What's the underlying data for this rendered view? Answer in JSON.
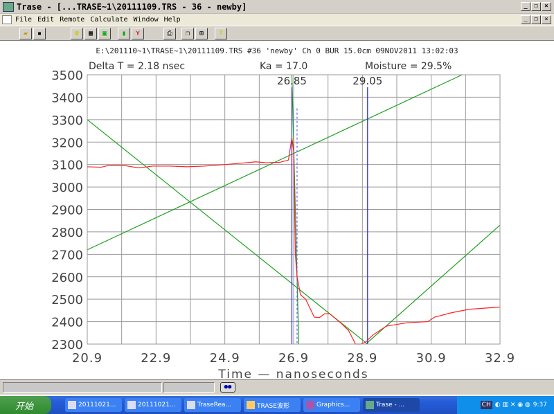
{
  "window": {
    "title": "Trase - [...TRASE~1\\20111109.TRS - 36 - newby]"
  },
  "menu": [
    "File",
    "Edit",
    "Remote",
    "Calculate",
    "Window",
    "Help"
  ],
  "toolbar": [
    "open-icon",
    "save-icon",
    "phone-icon",
    "table-icon",
    "monitor-icon",
    "green-doc-icon",
    "waveform-icon",
    "print-icon",
    "cascade-icon",
    "tile-icon",
    "help-icon"
  ],
  "header": {
    "file_info": "E:\\201110~1\\TRASE~1\\20111109.TRS #36 'newby' Ch 0  BUR 15.0cm  09NOV2011 13:02:03",
    "delta_t": "Delta T = 2.18 nsec",
    "ka": "Ka = 17.0",
    "moisture": "Moisture = 29.5%"
  },
  "chart_data": {
    "type": "line",
    "xlabel": "Time — nanoseconds",
    "ylabel": "",
    "xlim": [
      20.9,
      32.9
    ],
    "ylim": [
      2300,
      3500
    ],
    "xticks": [
      "20.9",
      "22.9",
      "24.9",
      "26.9",
      "28.9",
      "30.9",
      "32.9"
    ],
    "yticks": [
      "3500",
      "3400",
      "3300",
      "3200",
      "3100",
      "3000",
      "2900",
      "2800",
      "2700",
      "2600",
      "2500",
      "2400",
      "2300"
    ],
    "grid": true,
    "series": [
      {
        "color": "#ff2020",
        "x": [
          20.9,
          21.3,
          21.5,
          22.0,
          22.4,
          22.8,
          23.3,
          23.8,
          24.3,
          24.9,
          25.3,
          25.8,
          26.1,
          26.5,
          26.75,
          26.85,
          26.9,
          26.95,
          27.0,
          27.1,
          27.25,
          27.5,
          27.65,
          27.8,
          27.95,
          28.3,
          28.5,
          28.7,
          28.85,
          29.0,
          29.2,
          29.4,
          29.6,
          29.8,
          30.2,
          30.8,
          31.0,
          31.5,
          32.0,
          32.9
        ],
        "y": [
          3090,
          3088,
          3095,
          3095,
          3085,
          3093,
          3093,
          3090,
          3093,
          3100,
          3105,
          3112,
          3108,
          3110,
          3120,
          3220,
          3160,
          2700,
          2600,
          2520,
          2500,
          2420,
          2418,
          2435,
          2435,
          2390,
          2360,
          2300,
          2300,
          2310,
          2340,
          2360,
          2380,
          2385,
          2395,
          2400,
          2420,
          2440,
          2455,
          2465
        ]
      }
    ],
    "tangent_lines": [
      {
        "color": "#20a020",
        "x": [
          20.9,
          29.05
        ],
        "y": [
          3300,
          2300
        ]
      },
      {
        "color": "#20a020",
        "x": [
          20.9,
          31.8
        ],
        "y": [
          2720,
          3500
        ]
      },
      {
        "color": "#20a020",
        "x": [
          26.85,
          27.05
        ],
        "y": [
          3500,
          2300
        ]
      },
      {
        "color": "#20a020",
        "x": [
          29.0,
          32.9
        ],
        "y": [
          2300,
          2830
        ]
      }
    ],
    "markers": [
      {
        "x": 26.85,
        "label": "26.85",
        "color": "#2020ff"
      },
      {
        "x": 29.05,
        "label": "29.05",
        "color": "#2020ff"
      }
    ],
    "dotted_marker": {
      "x": 27.0,
      "y": [
        2300,
        3350
      ],
      "color": "#6060ff"
    }
  },
  "taskbar": {
    "start": "开始",
    "tasks": [
      "20111021...",
      "20111021...",
      "TraseRea...",
      "TRASE波形",
      "Graphics...",
      "Trase - ..."
    ],
    "lang": "CH",
    "clock": "9:37"
  }
}
